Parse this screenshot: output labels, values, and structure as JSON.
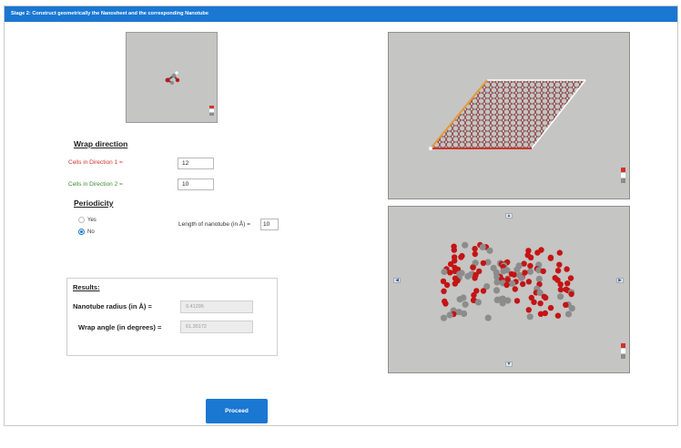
{
  "header": {
    "title": "Stage 2: Construct geometrically the Nanosheet and the corresponding Nanotube"
  },
  "wrap": {
    "title": "Wrap direction",
    "dir1_label": "Cells in Direction 1 =",
    "dir1_value": "12",
    "dir2_label": "Cells in Direction 2 =",
    "dir2_value": "10"
  },
  "periodicity": {
    "title": "Periodicity",
    "yes_label": "Yes",
    "no_label": "No",
    "selected": "No",
    "length_label": "Length of nanotube (in Å) =",
    "length_value": "10"
  },
  "results": {
    "title": "Results:",
    "radius_label": "Nanotube radius (in Å) =",
    "radius_value": "9.41295",
    "angle_label": "Wrap angle (in degrees) =",
    "angle_value": "61.35172"
  },
  "proceed_label": "Proceed",
  "colors": {
    "header": "#1a77d2",
    "viewer_bg": "#c5c5c3",
    "dir1": "#d0342c",
    "dir2": "#3e8e2f",
    "oxygen": "#c41414",
    "metal": "#8c8c8c"
  },
  "icons": {
    "arrow_up": "arrow-up-icon",
    "arrow_down": "arrow-down-icon",
    "arrow_left": "arrow-left-icon",
    "arrow_right": "arrow-right-icon"
  }
}
